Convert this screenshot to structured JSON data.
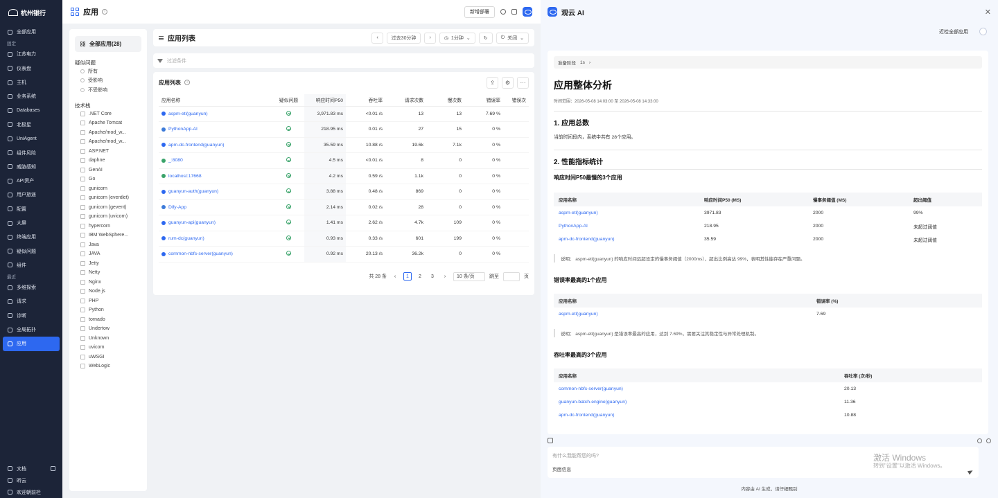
{
  "sidebar": {
    "brand": "杭州银行",
    "top_item": "全部应用",
    "pinned_section": "固定",
    "pinned": [
      "江苏电力",
      "仪表盘",
      "主机",
      "业务系统",
      "Databases",
      "北极星",
      "UniAgent",
      "组件风险",
      "威胁感知",
      "API资产",
      "用户旅途",
      "配置",
      "大屏",
      "终端应用",
      "疑似问题",
      "组件"
    ],
    "recent_section": "最近",
    "recent": [
      "多维探索",
      "请求",
      "诊断",
      "全局拓扑",
      "应用"
    ],
    "active": "应用",
    "bottom": [
      "文档",
      "昕云",
      "欢迎朝前栏"
    ]
  },
  "topbar": {
    "title": "应用",
    "new_dept_button": "新增部署"
  },
  "filter_panel": {
    "all_apps": "全部应用(28)",
    "suspect_heading": "疑似问题",
    "suspect_options": [
      "所有",
      "受影响",
      "不受影响"
    ],
    "tech_heading": "技术栈",
    "tech": [
      ".NET Core",
      "Apache Tomcat",
      "Apache/mod_w...",
      "Apache/mod_w...",
      "ASP.NET",
      "daphne",
      "GenAI",
      "Go",
      "gunicorn",
      "gunicorn (eventlet)",
      "gunicorn (gevent)",
      "gunicorn (uvicorn)",
      "hypercorn",
      "IBM WebSphere...",
      "Java",
      "JAVA",
      "Jetty",
      "Netty",
      "Nginx",
      "Node.js",
      "PHP",
      "Python",
      "tornado",
      "Undertow",
      "Unknown",
      "uvicorn",
      "uWSGI",
      "WebLogic"
    ]
  },
  "list_header": {
    "title": "应用列表",
    "time_range": "过去30分钟",
    "refresh": "1分钟",
    "close_label": "关闭"
  },
  "filter_bar": {
    "placeholder": "过滤条件"
  },
  "table": {
    "title": "应用列表",
    "columns": [
      "应用名称",
      "疑似问题",
      "响应时间P50",
      "吞吐率",
      "请求次数",
      "慢次数",
      "错误率",
      "错误次"
    ],
    "rows": [
      {
        "name": "aspm-etl(guanyun)",
        "color": "#2d68f0",
        "p50": "3,971.83 ms",
        "tp": "<0.01 /s",
        "req": "13",
        "slow": "13",
        "err": "7.69 %"
      },
      {
        "name": "PythonApp-AI",
        "color": "#3d7bd9",
        "p50": "218.95 ms",
        "tp": "0.01 /s",
        "req": "27",
        "slow": "15",
        "err": "0 %"
      },
      {
        "name": "apm-dc-frontend(guanyun)",
        "color": "#2d68f0",
        "p50": "35.59 ms",
        "tp": "10.88 /s",
        "req": "19.6k",
        "slow": "7.1k",
        "err": "0 %"
      },
      {
        "name": "_:8080",
        "color": "#3aa36a",
        "p50": "4.5 ms",
        "tp": "<0.01 /s",
        "req": "8",
        "slow": "0",
        "err": "0 %"
      },
      {
        "name": "localhost:17668",
        "color": "#3aa36a",
        "p50": "4.2 ms",
        "tp": "0.59 /s",
        "req": "1.1k",
        "slow": "0",
        "err": "0 %"
      },
      {
        "name": "guanyun-auth(guanyun)",
        "color": "#2d68f0",
        "p50": "3.88 ms",
        "tp": "0.48 /s",
        "req": "869",
        "slow": "0",
        "err": "0 %"
      },
      {
        "name": "Dify-App",
        "color": "#3d7bd9",
        "p50": "2.14 ms",
        "tp": "0.02 /s",
        "req": "28",
        "slow": "0",
        "err": "0 %"
      },
      {
        "name": "guanyun-api(guanyun)",
        "color": "#2d68f0",
        "p50": "1.41 ms",
        "tp": "2.62 /s",
        "req": "4.7k",
        "slow": "109",
        "err": "0 %"
      },
      {
        "name": "rum-dc(guanyun)",
        "color": "#2d68f0",
        "p50": "0.93 ms",
        "tp": "0.33 /s",
        "req": "601",
        "slow": "199",
        "err": "0 %"
      },
      {
        "name": "common-nbfs-server(guanyun)",
        "color": "#2d68f0",
        "p50": "0.92 ms",
        "tp": "20.13 /s",
        "req": "36.2k",
        "slow": "0",
        "err": "0 %"
      }
    ]
  },
  "pager": {
    "total": "共 28 条",
    "pages": [
      "1",
      "2",
      "3"
    ],
    "current": "1",
    "page_size": "10 条/页",
    "jump_label": "跳至",
    "page_unit": "页"
  },
  "ai": {
    "title": "观云 AI",
    "user_label": "近检全部应用",
    "step": "准备阶段",
    "step_time": "1s",
    "report_title": "应用整体分析",
    "time_range": "时间范围：2026-05-08 14:03:00 至 2026-05-08 14:33:00",
    "s1_title": "1. 应用总数",
    "s1_text": "当前时间段内，系统中共有 28个应用。",
    "s2_title": "2. 性能指标统计",
    "slow_title": "响应时间P50最慢的3个应用",
    "slow_cols": [
      "应用名称",
      "响应时间P50 (MS)",
      "慢事务阈值 (MS)",
      "超出阈值"
    ],
    "slow_rows": [
      [
        "aspm-etl(guanyun)",
        "3971.83",
        "2000",
        "99%"
      ],
      [
        "PythonApp-AI",
        "218.95",
        "2000",
        "未超过阈值"
      ],
      [
        "apm-dc-frontend(guanyun)",
        "35.59",
        "2000",
        "未超过阈值"
      ]
    ],
    "slow_note": "说明： aspm-etl(guanyun) 的响应时间远超设定的慢事务阈值（2000ms），超出比例高达 99%，表明其性能存在严重问题。",
    "err_title": "错误率最高的1个应用",
    "err_cols": [
      "应用名称",
      "错误率 (%)"
    ],
    "err_rows": [
      [
        "aspm-etl(guanyun)",
        "7.69"
      ]
    ],
    "err_note": "说明： aspm-etl(guanyun) 是错误率最高的应用，达到 7.69%，需要关注其稳定性与异常处理机制。",
    "tp_title": "吞吐率最高的3个应用",
    "tp_cols": [
      "应用名称",
      "吞吐率 (次/秒)"
    ],
    "tp_rows": [
      [
        "common-nbfs-server(guanyun)",
        "20.13"
      ],
      [
        "guanyun-batch-engine(guanyun)",
        "11.36"
      ],
      [
        "apm-dc-frontend(guanyun)",
        "10.88"
      ]
    ],
    "input_placeholder": "有什么我能帮您的吗?",
    "page_info": "页面信息",
    "footer": "内容由 AI 生成，请仔细甄别"
  },
  "watermark": {
    "line1": "激活 Windows",
    "line2": "转到\"设置\"以激活 Windows。"
  }
}
